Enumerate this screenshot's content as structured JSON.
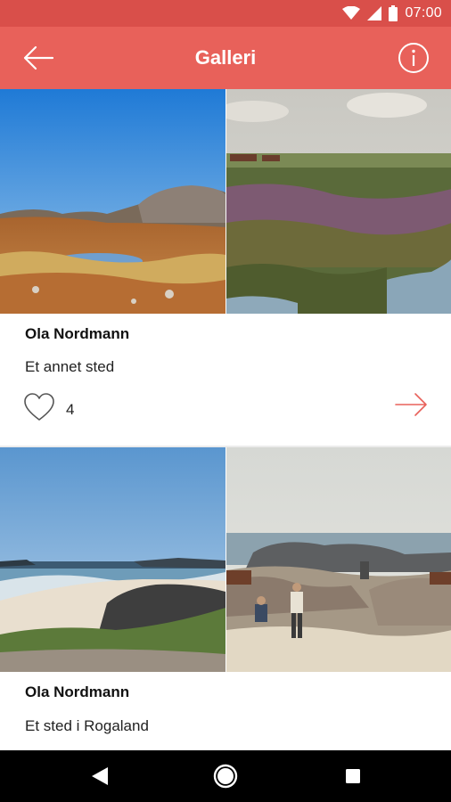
{
  "status_bar": {
    "time": "07:00",
    "icons": [
      "wifi-icon",
      "cell-signal-icon",
      "battery-icon"
    ]
  },
  "app_bar": {
    "title": "Galleri",
    "back_icon": "arrow-left-icon",
    "info_icon": "info-icon",
    "color": "#e8615a"
  },
  "feed": {
    "items": [
      {
        "author": "Ola Nordmann",
        "place": "Et annet sted",
        "likes": "4",
        "photo_left": "photo-landscape-pond",
        "photo_right": "painting-moorland"
      },
      {
        "author": "Ola Nordmann",
        "place": "Et sted i Rogaland",
        "photo_left": "photo-beach",
        "photo_right": "painting-rocky-shore"
      }
    ]
  },
  "nav_bar": {
    "buttons": [
      "nav-back-icon",
      "nav-home-icon",
      "nav-recents-icon"
    ]
  },
  "colors": {
    "accent": "#e8615a",
    "status_bar": "#d94f4a"
  }
}
